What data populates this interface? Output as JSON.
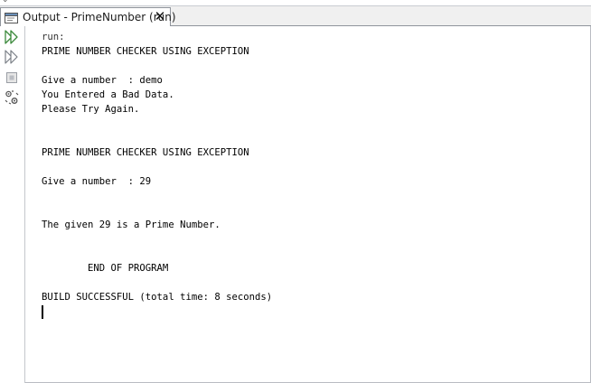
{
  "tab": {
    "title": "Output - PrimeNumber (run)",
    "close_glyph": "✕",
    "icon": "output-window-icon"
  },
  "toolbar": {
    "icons": [
      "rerun-icon",
      "rerun-with-options-icon",
      "stop-icon",
      "settings-icon"
    ]
  },
  "console": {
    "lines": [
      "run:",
      "PRIME NUMBER CHECKER USING EXCEPTION",
      "",
      "Give a number  : demo",
      "You Entered a Bad Data.",
      "Please Try Again.",
      "",
      "",
      "PRIME NUMBER CHECKER USING EXCEPTION",
      "",
      "Give a number  : 29",
      "",
      "",
      "The given 29 is a Prime Number.",
      "",
      "",
      "        END OF PROGRAM",
      "",
      "BUILD SUCCESSFUL (total time: 8 seconds)"
    ]
  },
  "colors": {
    "accent_green": "#3c8a3c",
    "icon_gray": "#7a7f86"
  }
}
